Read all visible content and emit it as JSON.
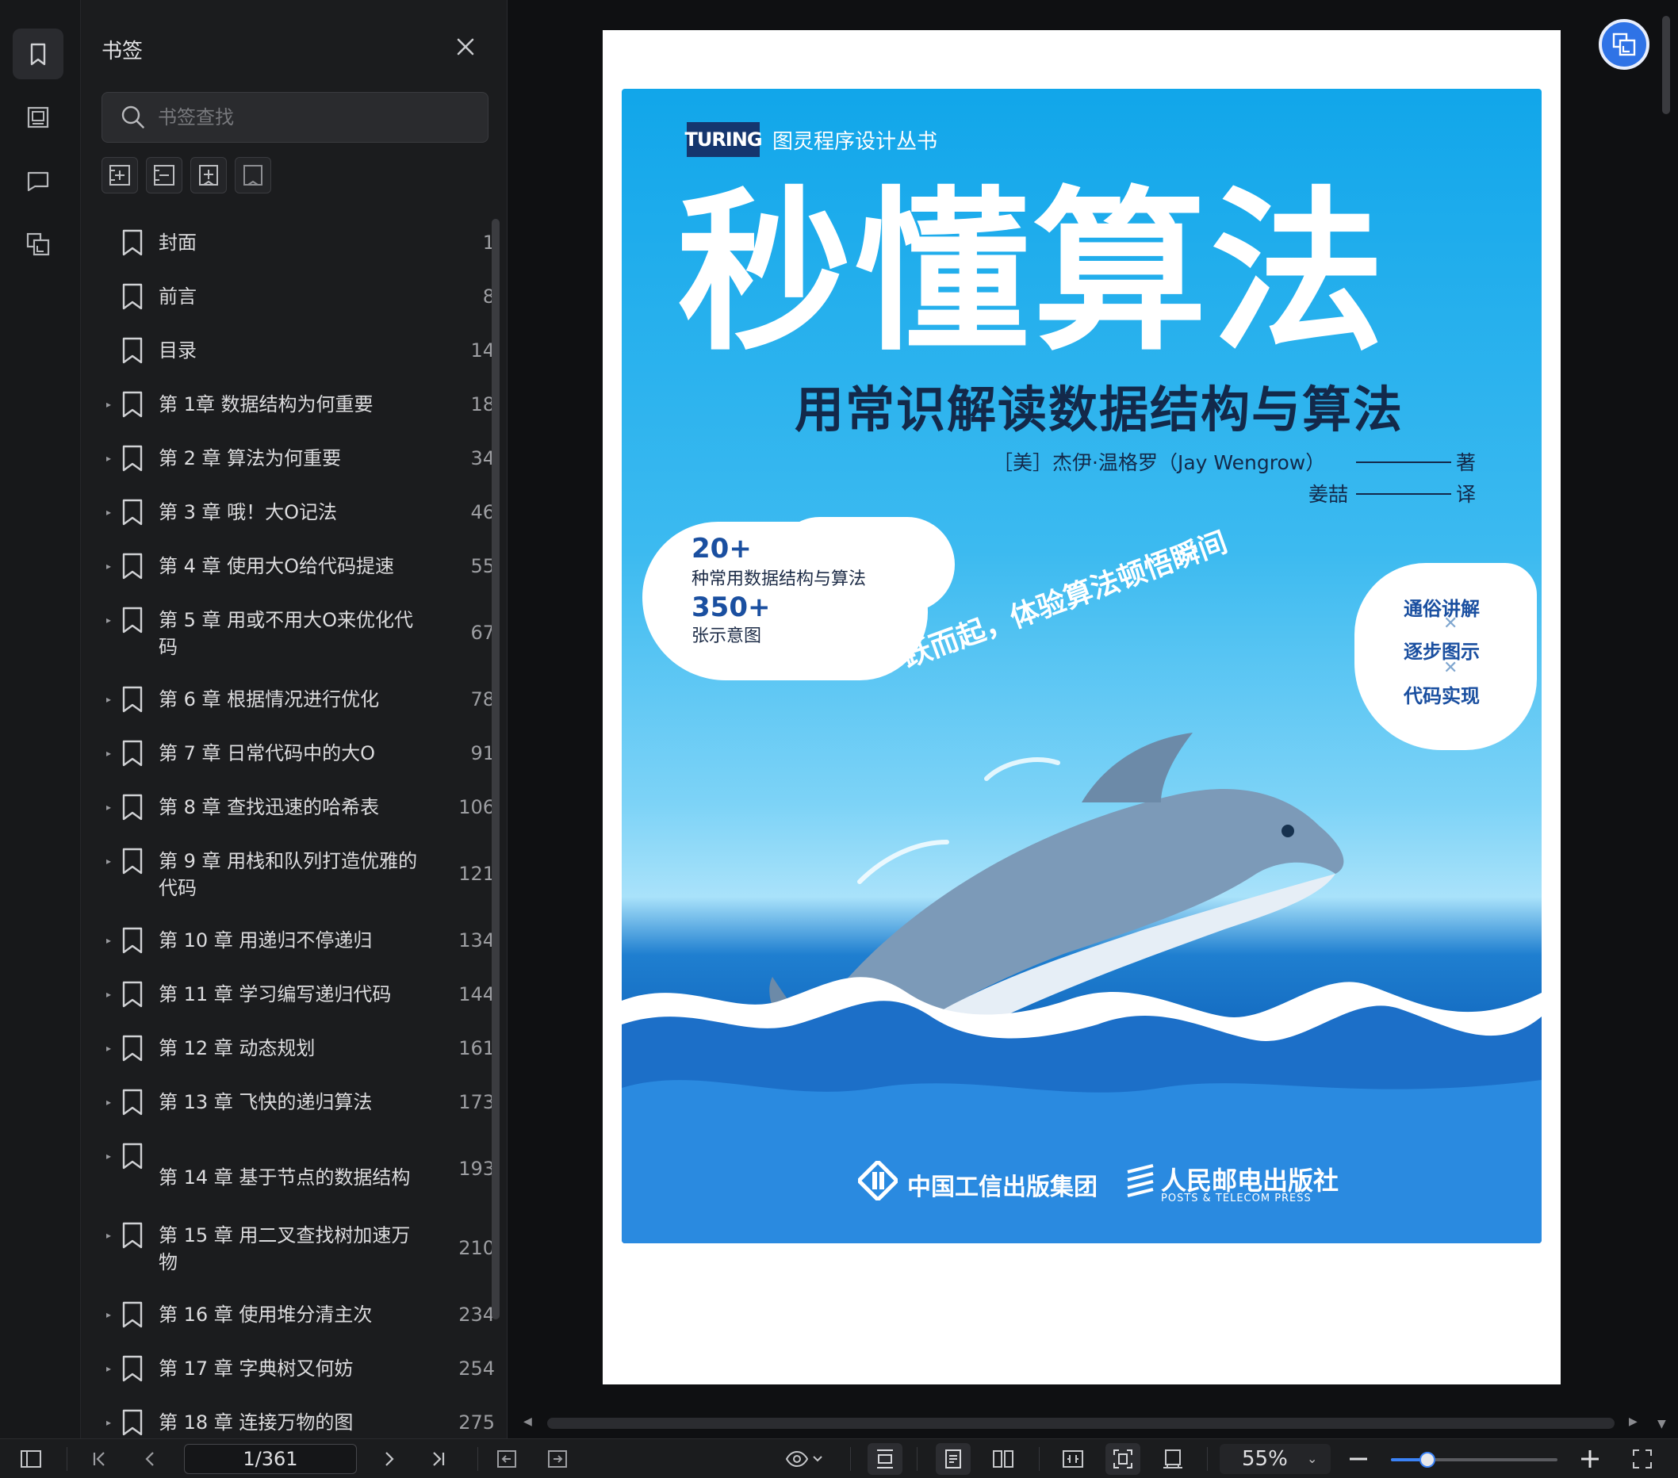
{
  "sidebar": {
    "title": "书签",
    "search_placeholder": "书签查找",
    "bookmarks": [
      {
        "label": "封面",
        "page": "1",
        "expandable": false,
        "lines": 1
      },
      {
        "label": "前言",
        "page": "8",
        "expandable": false,
        "lines": 1
      },
      {
        "label": "目录",
        "page": "14",
        "expandable": false,
        "lines": 1
      },
      {
        "label": "第 1章 数据结构为何重要",
        "page": "18",
        "expandable": true,
        "lines": 1
      },
      {
        "label": "第 2 章 算法为何重要",
        "page": "34",
        "expandable": true,
        "lines": 1
      },
      {
        "label": "第 3 章 哦！大O记法",
        "page": "46",
        "expandable": true,
        "lines": 1
      },
      {
        "label": "第 4 章 使用大O给代码提速",
        "page": "55",
        "expandable": true,
        "lines": 1
      },
      {
        "label": "第 5 章 用或不用大O来优化代码",
        "page": "67",
        "expandable": true,
        "lines": 2
      },
      {
        "label": "第 6 章 根据情况进行优化",
        "page": "78",
        "expandable": true,
        "lines": 1
      },
      {
        "label": "第 7 章 日常代码中的大O",
        "page": "91",
        "expandable": true,
        "lines": 1
      },
      {
        "label": "第 8 章 查找迅速的哈希表",
        "page": "106",
        "expandable": true,
        "lines": 1
      },
      {
        "label": "第 9 章 用栈和队列打造优雅的代码",
        "page": "121",
        "expandable": true,
        "lines": 2
      },
      {
        "label": "第 10 章 用递归不停递归",
        "page": "134",
        "expandable": true,
        "lines": 1
      },
      {
        "label": "第 11 章 学习编写递归代码",
        "page": "144",
        "expandable": true,
        "lines": 1
      },
      {
        "label": "第 12 章 动态规划",
        "page": "161",
        "expandable": true,
        "lines": 1
      },
      {
        "label": "第 13 章 飞快的递归算法",
        "page": "173",
        "expandable": true,
        "lines": 1
      },
      {
        "label": "第 14 章 基于节点的数据结构",
        "page": "193",
        "expandable": true,
        "lines": 2,
        "bottom_aligned": true
      },
      {
        "label": "第 15 章 用二叉查找树加速万物",
        "page": "210",
        "expandable": true,
        "lines": 2
      },
      {
        "label": "第 16 章 使用堆分清主次",
        "page": "234",
        "expandable": true,
        "lines": 1
      },
      {
        "label": "第 17 章 字典树又何妨",
        "page": "254",
        "expandable": true,
        "lines": 1
      },
      {
        "label": "第 18 章 连接万物的图",
        "page": "275",
        "expandable": true,
        "lines": 1
      }
    ]
  },
  "cover": {
    "series_logo": "TURING",
    "series": "图灵程序设计丛书",
    "title": "秒懂算法",
    "subtitle": "用常识解读数据结构与算法",
    "author": "［美］杰伊·温格罗（Jay Wengrow）",
    "author_role": "著",
    "translator": "姜喆",
    "translator_role": "译",
    "stat1_num": "20+",
    "stat1_label": "种常用数据结构与算法",
    "stat2_num": "350+",
    "stat2_label": "张示意图",
    "slogan": "一跃而起，体验算法顿悟瞬间",
    "features": [
      "通俗讲解",
      "逐步图示",
      "代码实现"
    ],
    "publisher1": "中国工信出版集团",
    "publisher2": "人民邮电出版社",
    "publisher2_en": "POSTS & TELECOM PRESS"
  },
  "toolbar": {
    "page_indicator": "1/361",
    "zoom": "55%",
    "zoom_fraction": 0.22,
    "accent": "#3b82f6"
  }
}
